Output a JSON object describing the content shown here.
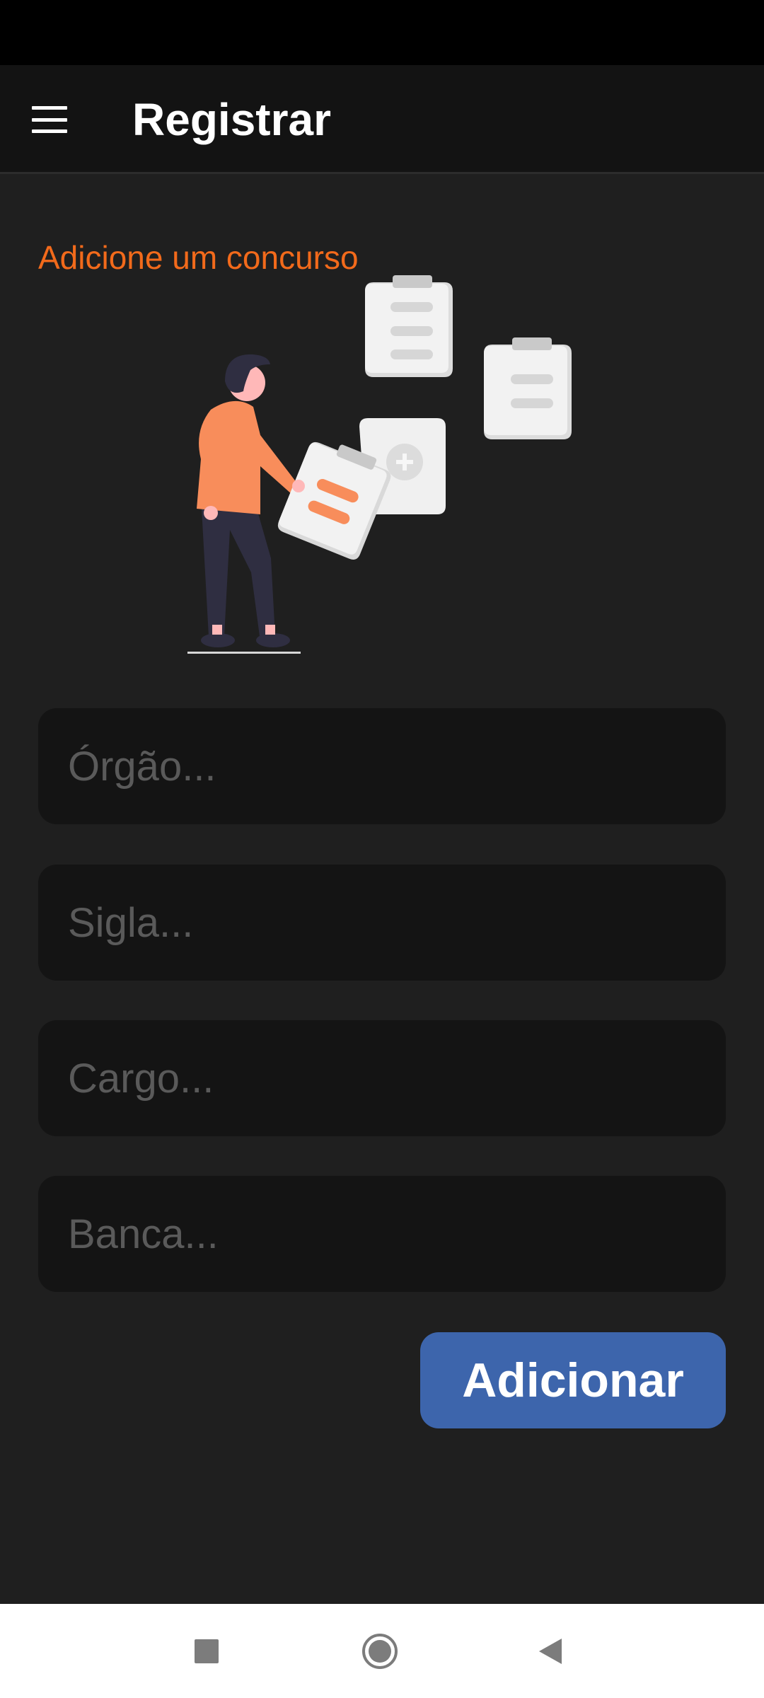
{
  "app_bar": {
    "menu_icon": "hamburger-menu-icon",
    "title": "Registrar"
  },
  "section": {
    "title": "Adicione um concurso"
  },
  "illustration": {
    "icon": "person-with-clipboards-illustration",
    "colors": {
      "accent": "#f88d5b",
      "paper": "#f2f2f2",
      "dark": "#2f2e41"
    }
  },
  "form": {
    "orgao": {
      "value": "",
      "placeholder": "Órgão..."
    },
    "sigla": {
      "value": "",
      "placeholder": "Sigla..."
    },
    "cargo": {
      "value": "",
      "placeholder": "Cargo..."
    },
    "banca": {
      "value": "",
      "placeholder": "Banca..."
    },
    "submit_label": "Adicionar"
  },
  "colors": {
    "accent_text": "#f26a1b",
    "button": "#3d65ac",
    "background": "#1f1f1f",
    "field": "#141414"
  },
  "nav_bar": {
    "recents_icon": "square-recents-icon",
    "home_icon": "circle-home-icon",
    "back_icon": "triangle-back-icon"
  }
}
